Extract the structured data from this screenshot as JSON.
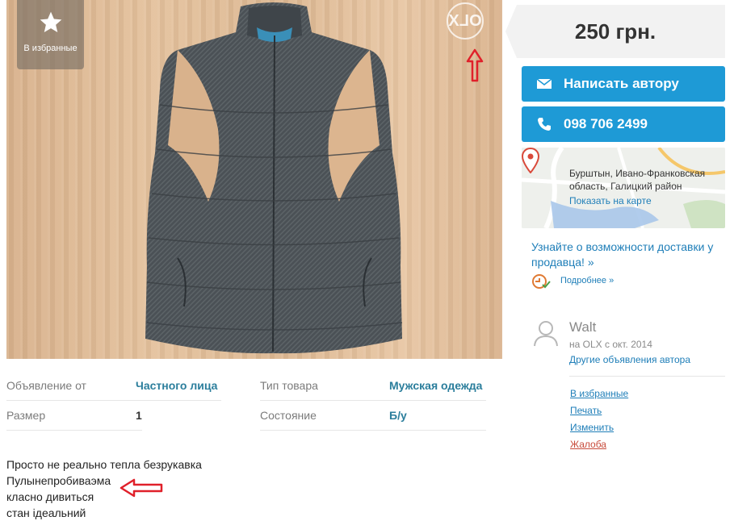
{
  "photo": {
    "favorite_label": "В избранные",
    "watermark_text": "OLX",
    "icons": [
      "star-icon",
      "red-arrow-up-icon"
    ]
  },
  "details": {
    "row1": {
      "label_a": "Объявление от",
      "value_a": "Частного лица",
      "label_b": "Тип товара",
      "value_b": "Мужская одежда"
    },
    "row2": {
      "label_a": "Размер",
      "value_a": "1",
      "label_b": "Состояние",
      "value_b": "Б/у"
    }
  },
  "description": {
    "lines": [
      "Просто не реально тепла безрукавка",
      "Пулынепробиваэма",
      "класно дивиться",
      "стан ідеальний"
    ]
  },
  "sidebar": {
    "price": "250 грн.",
    "message_button": "Написать автору",
    "phone_button": "098 706 2499",
    "location": {
      "line1": "Бурштын, Ивано-Франковская",
      "line2": "область, Галицкий район",
      "map_link": "Показать на карте"
    },
    "delivery": {
      "link": "Узнайте о возможности доставки у продавца! »",
      "more": "Подробнее »"
    },
    "seller": {
      "name": "Walt",
      "since": "на OLX с окт. 2014",
      "other_ads": "Другие объявления автора"
    },
    "actions": {
      "favorite": "В избранные",
      "print": "Печать",
      "edit": "Изменить",
      "complaint": "Жалоба"
    }
  },
  "colors": {
    "accent": "#1e9ad6",
    "link": "#1e7eb8",
    "value": "#2b7e9c",
    "complaint": "#c84b3b",
    "annotation_arrow": "#e0202a"
  }
}
